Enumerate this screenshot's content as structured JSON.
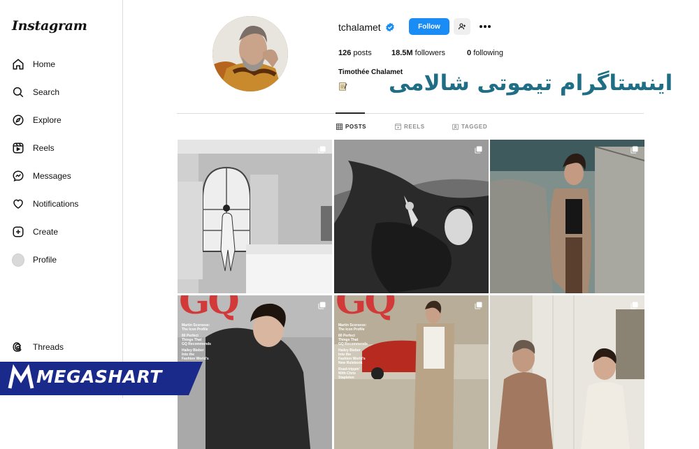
{
  "app": {
    "logo": "Instagram"
  },
  "sidebar": {
    "items": [
      {
        "label": "Home",
        "icon": "home-icon"
      },
      {
        "label": "Search",
        "icon": "search-icon"
      },
      {
        "label": "Explore",
        "icon": "compass-icon"
      },
      {
        "label": "Reels",
        "icon": "reels-icon"
      },
      {
        "label": "Messages",
        "icon": "messenger-icon"
      },
      {
        "label": "Notifications",
        "icon": "heart-icon"
      },
      {
        "label": "Create",
        "icon": "plus-square-icon"
      },
      {
        "label": "Profile",
        "icon": "avatar"
      }
    ],
    "threads": {
      "label": "Threads",
      "icon": "threads-icon"
    }
  },
  "profile": {
    "username": "tchalamet",
    "follow_label": "Follow",
    "stats": {
      "posts_count": "126",
      "posts_label": "posts",
      "followers_count": "18.5M",
      "followers_label": "followers",
      "following_count": "0",
      "following_label": "following"
    },
    "full_name": "Timothée Chalamet"
  },
  "overlay": {
    "persian_title": "اینستاگرام تیموتی شالامی",
    "watermark": "MEGASHART"
  },
  "tabs": [
    {
      "label": "POSTS",
      "active": true,
      "icon": "grid-icon"
    },
    {
      "label": "REELS",
      "active": false,
      "icon": "reels-icon"
    },
    {
      "label": "TAGGED",
      "active": false,
      "icon": "tagged-icon"
    }
  ],
  "posts": {
    "gq1": {
      "logo": "GQ",
      "lines": [
        "Martin Scorsese:",
        "The Icon Profile",
        "80 Perfect",
        "Things That",
        "GQ Recommends",
        "Hailey Bieber",
        "Into the",
        "Fashion World's"
      ]
    },
    "gq2": {
      "logo": "GQ",
      "lines": [
        "Martin Scorsese:",
        "The Icon Profile",
        "80 Perfect",
        "Things That",
        "GQ Recommends",
        "Hailey Bieber",
        "Into the",
        "Fashion World's",
        "New Rulebook",
        "Road-trippin'",
        "With Chris",
        "Stapleton"
      ]
    }
  },
  "colors": {
    "accent": "#1a8cf5",
    "persian_text": "#1f6e86",
    "watermark_bg": "#1a2a8a"
  }
}
